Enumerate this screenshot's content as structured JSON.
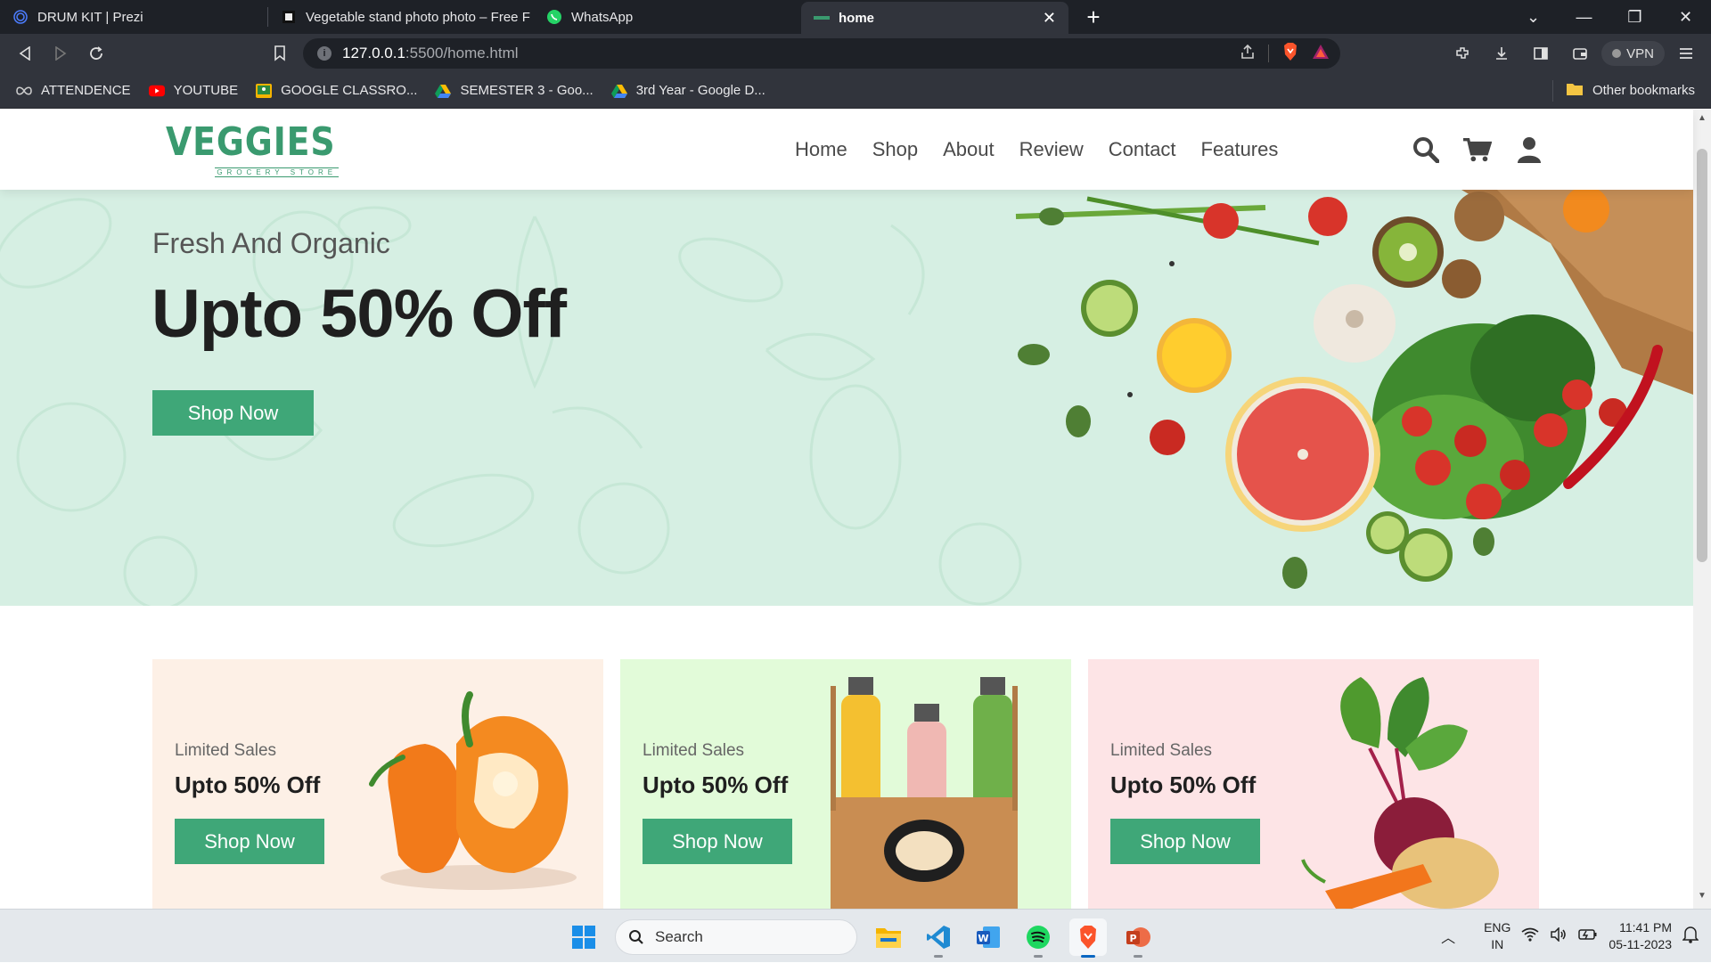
{
  "browser": {
    "tabs": [
      {
        "title": "DRUM KIT | Prezi",
        "active": false
      },
      {
        "title": "Vegetable stand photo photo – Free F",
        "active": false
      },
      {
        "title": "WhatsApp",
        "active": false
      },
      {
        "title": "home",
        "active": true
      }
    ],
    "address": {
      "host": "127.0.0.1",
      "path": ":5500/home.html"
    },
    "vpn_label": "VPN",
    "bookmarks": [
      {
        "label": "ATTENDENCE",
        "icon": "infinity-icon"
      },
      {
        "label": "YOUTUBE",
        "icon": "youtube-icon"
      },
      {
        "label": "GOOGLE CLASSRO...",
        "icon": "classroom-icon"
      },
      {
        "label": "SEMESTER 3 - Goo...",
        "icon": "drive-icon"
      },
      {
        "label": "3rd Year - Google D...",
        "icon": "drive-icon"
      }
    ],
    "other_bookmarks": "Other bookmarks"
  },
  "site": {
    "logo": {
      "name": "VEGGIES",
      "tagline": "GROCERY STORE"
    },
    "nav": [
      "Home",
      "Shop",
      "About",
      "Review",
      "Contact",
      "Features"
    ],
    "hero": {
      "subtitle": "Fresh And Organic",
      "title": "Upto 50% Off",
      "button": "Shop Now"
    },
    "cards": [
      {
        "subtitle": "Limited Sales",
        "title": "Upto 50% Off",
        "button": "Shop Now",
        "bg": "#fdf0e6",
        "art": "pepper"
      },
      {
        "subtitle": "Limited Sales",
        "title": "Upto 50% Off",
        "button": "Shop Now",
        "bg": "#e2fbd9",
        "art": "juice"
      },
      {
        "subtitle": "Limited Sales",
        "title": "Upto 50% Off",
        "button": "Shop Now",
        "bg": "#fde4e6",
        "art": "beet"
      }
    ],
    "accent": "#3fa778"
  },
  "taskbar": {
    "search_placeholder": "Search",
    "lang": {
      "line1": "ENG",
      "line2": "IN"
    },
    "time": "11:41 PM",
    "date": "05-11-2023"
  }
}
